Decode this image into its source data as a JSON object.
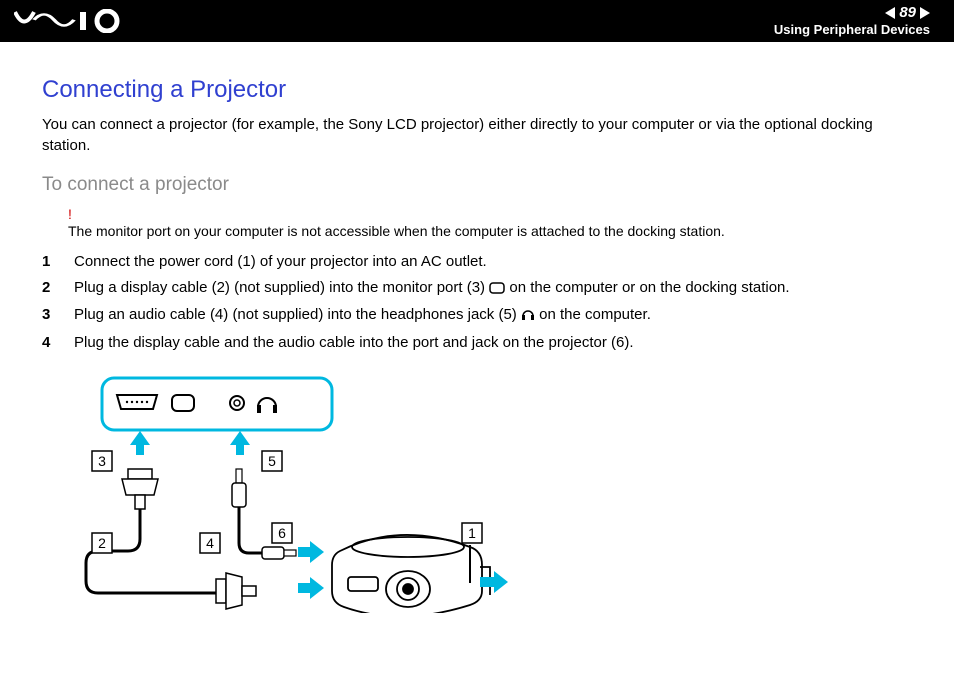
{
  "header": {
    "page_number": "89",
    "section": "Using Peripheral Devices"
  },
  "title": "Connecting a Projector",
  "intro": "You can connect a projector (for example, the Sony LCD projector) either directly to your computer or via the optional docking station.",
  "procedure_title": "To connect a projector",
  "note": {
    "symbol": "!",
    "text": "The monitor port on your computer is not accessible when the computer is attached to the docking station."
  },
  "steps": [
    {
      "n": "1",
      "text": "Connect the power cord (1) of your projector into an AC outlet."
    },
    {
      "n": "2",
      "pre": "Plug a display cable (2) (not supplied) into the monitor port (3) ",
      "post": " on the computer or on the docking station.",
      "icon": "monitor-port-icon"
    },
    {
      "n": "3",
      "pre": "Plug an audio cable (4) (not supplied) into the headphones jack (5) ",
      "post": " on the computer.",
      "icon": "headphones-icon"
    },
    {
      "n": "4",
      "text": "Plug the display cable and the audio cable into the port and jack on the projector (6)."
    }
  ],
  "figure_alt": "Diagram of computer ports (3 monitor port, 5 headphones jack) and cables (2 display cable, 4 audio cable) connecting to a projector (6) with its power cord (1).",
  "callouts": [
    "1",
    "2",
    "3",
    "4",
    "5",
    "6"
  ]
}
